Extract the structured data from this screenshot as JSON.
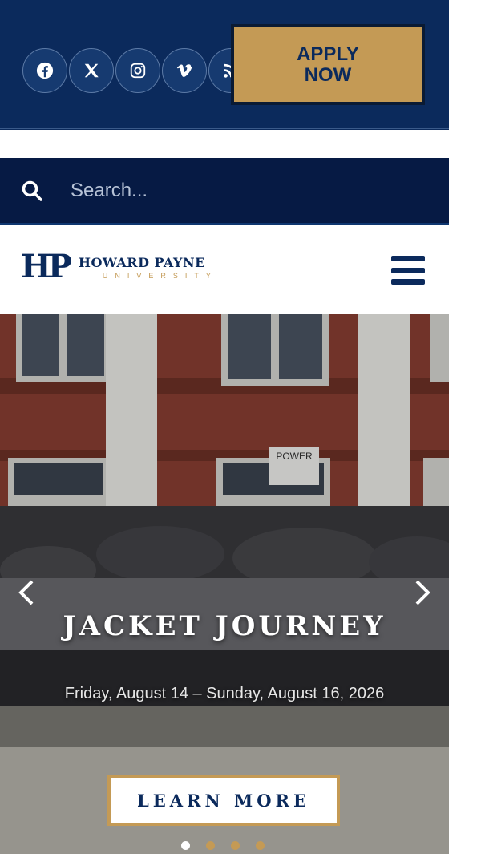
{
  "topbar": {
    "socials": [
      {
        "icon": "facebook-icon"
      },
      {
        "icon": "x-icon"
      },
      {
        "icon": "instagram-icon"
      },
      {
        "icon": "vimeo-icon"
      },
      {
        "icon": "rss-icon"
      }
    ],
    "apply_label": "APPLY\nNOW"
  },
  "search": {
    "placeholder": "Search..."
  },
  "header": {
    "logo_mark": "HP",
    "logo_name": "HOWARD PAYNE",
    "logo_sub": "UNIVERSITY"
  },
  "hero": {
    "sign_text": "POWER",
    "title": "JACKET JOURNEY",
    "date": "Friday, August 14 – Sunday, August 16, 2026",
    "cta_label": "LEARN MORE",
    "slide_count": 4,
    "active_slide": 1
  },
  "colors": {
    "navy": "#0b2a5c",
    "gold": "#c49a55",
    "search_bg": "#061a44"
  }
}
